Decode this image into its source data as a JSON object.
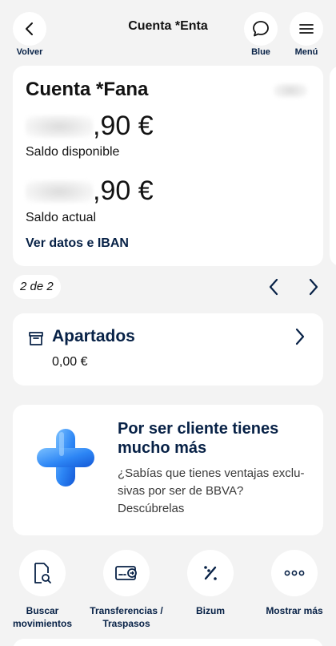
{
  "header": {
    "title": "Cuenta *Εnta",
    "back_label": "Volver",
    "chat_label": "Blue",
    "menu_label": "Menú",
    "icons": {
      "back": "chevron-left-icon",
      "chat": "chat-bubble-icon",
      "menu": "hamburger-menu-icon"
    }
  },
  "account_card": {
    "title": "Cuenta *Fana",
    "available_amount": ",90 €",
    "available_label": "Saldo disponible",
    "current_amount": ",90 €",
    "current_label": "Saldo actual",
    "iban_link": "Ver datos e IBAN"
  },
  "pager": {
    "text": "2 de 2"
  },
  "savings": {
    "title": "Apartados",
    "amount": "0,00 €",
    "icon": "box-icon"
  },
  "promo": {
    "title": "Por ser cliente tienes mucho más",
    "body": "¿Sabías que tienes ventajas exclu-sivas por ser de BBVA? Descúbrelas",
    "icon": "plus-3d-icon"
  },
  "actions": [
    {
      "label": "Buscar movimientos",
      "icon": "search-document-icon"
    },
    {
      "label": "Transferencias / Traspasos",
      "icon": "transfer-icon"
    },
    {
      "label": "Bizum",
      "icon": "bizum-icon"
    },
    {
      "label": "Mostrar más",
      "icon": "more-dots-icon"
    }
  ],
  "colors": {
    "navy": "#072146",
    "background": "#f3f3f3",
    "accent_blue": "#1464e0"
  }
}
